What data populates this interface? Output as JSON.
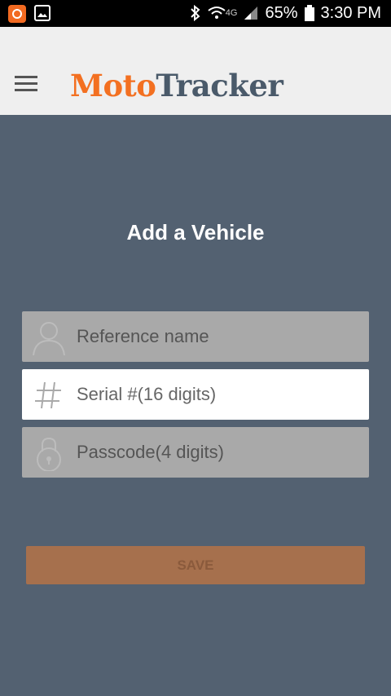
{
  "status_bar": {
    "battery": "65%",
    "time": "3:30 PM",
    "network": "4G"
  },
  "app_bar": {
    "brand_part1": "Moto",
    "brand_part2": "Tracker"
  },
  "page": {
    "title": "Add a Vehicle"
  },
  "form": {
    "reference_placeholder": "Reference name",
    "serial_placeholder": "Serial #(16 digits)",
    "passcode_placeholder": "Passcode(4 digits)",
    "save_label": "SAVE"
  },
  "colors": {
    "background": "#536171",
    "accent": "#f37021",
    "save_button": "#a6704d"
  }
}
